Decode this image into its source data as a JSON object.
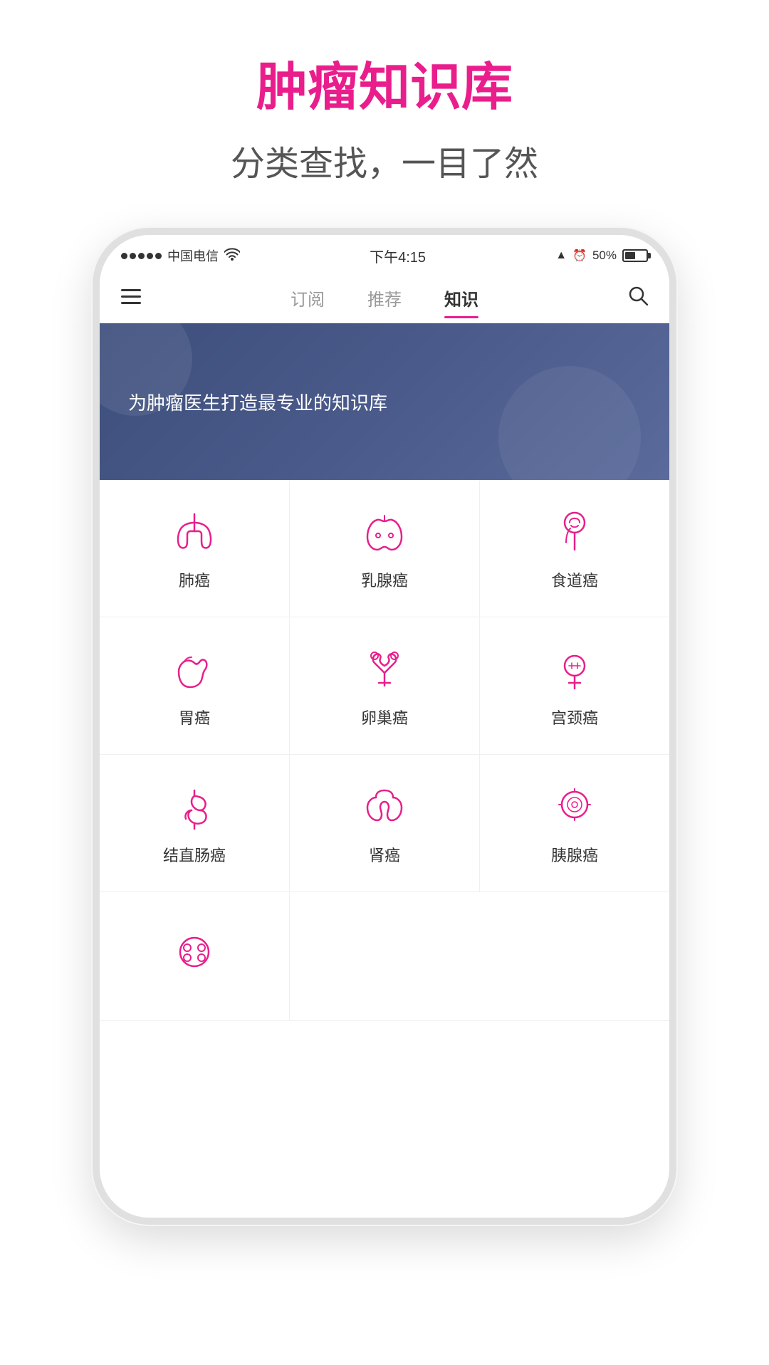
{
  "page": {
    "title": "肿瘤知识库",
    "subtitle": "分类查找，一目了然"
  },
  "status_bar": {
    "signal_dots": 5,
    "carrier": "中国电信",
    "wifi": "WiFi",
    "time": "下午4:15",
    "location": "▲",
    "alarm": "⏰",
    "battery_pct": "50%"
  },
  "nav": {
    "tabs": [
      {
        "id": "subscribe",
        "label": "订阅",
        "active": false
      },
      {
        "id": "recommend",
        "label": "推荐",
        "active": false
      },
      {
        "id": "knowledge",
        "label": "知识",
        "active": true
      }
    ]
  },
  "banner": {
    "text": "为肿瘤医生打造最专业的知识库"
  },
  "cancers": [
    {
      "id": "lung",
      "label": "肺癌",
      "icon": "lung"
    },
    {
      "id": "breast",
      "label": "乳腺癌",
      "icon": "breast"
    },
    {
      "id": "esophagus",
      "label": "食道癌",
      "icon": "esophagus"
    },
    {
      "id": "stomach",
      "label": "胃癌",
      "icon": "stomach"
    },
    {
      "id": "ovary",
      "label": "卵巢癌",
      "icon": "ovary"
    },
    {
      "id": "cervix",
      "label": "宫颈癌",
      "icon": "cervix"
    },
    {
      "id": "colorectal",
      "label": "结直肠癌",
      "icon": "colorectal"
    },
    {
      "id": "kidney",
      "label": "肾癌",
      "icon": "kidney"
    },
    {
      "id": "pancreas",
      "label": "胰腺癌",
      "icon": "pancreas"
    },
    {
      "id": "other",
      "label": "",
      "icon": "other"
    }
  ],
  "colors": {
    "pink": "#e91e8c",
    "banner_bg": "#3d4f7c"
  }
}
